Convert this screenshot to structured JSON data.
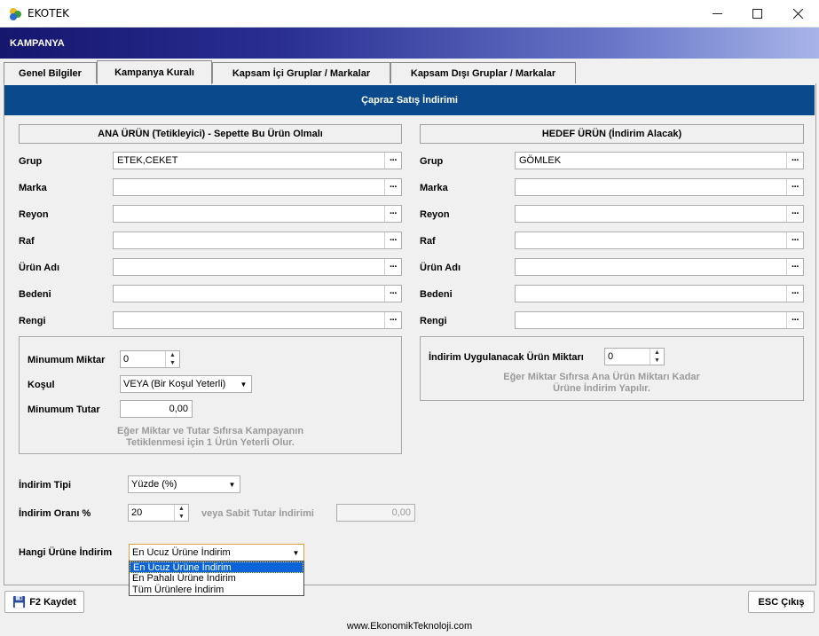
{
  "window": {
    "title": "EKOTEK"
  },
  "banner": {
    "title": "KAMPANYA"
  },
  "tabs": [
    {
      "label": "Genel Bilgiler"
    },
    {
      "label": "Kampanya Kuralı"
    },
    {
      "label": "Kapsam  İçi Gruplar / Markalar"
    },
    {
      "label": "Kapsam Dışı Gruplar / Markalar"
    }
  ],
  "section_title": "Çapraz Satış İndirimi",
  "left": {
    "header": "ANA ÜRÜN (Tetikleyici) - Sepette Bu Ürün Olmalı",
    "fields": [
      {
        "label": "Grup",
        "value": "ETEK,CEKET"
      },
      {
        "label": "Marka",
        "value": ""
      },
      {
        "label": "Reyon",
        "value": ""
      },
      {
        "label": "Raf",
        "value": ""
      },
      {
        "label": "Ürün Adı",
        "value": ""
      },
      {
        "label": "Bedeni",
        "value": ""
      },
      {
        "label": "Rengi",
        "value": ""
      }
    ],
    "min_qty_label": "Minumum Miktar",
    "min_qty_value": "0",
    "condition_label": "Koşul",
    "condition_value": "VEYA (Bir Koşul Yeterli)",
    "min_total_label": "Minumum Tutar",
    "min_total_value": "0,00",
    "hint_line1": "Eğer Miktar ve Tutar Sıfırsa Kampayanın",
    "hint_line2": "Tetiklenmesi için 1 Ürün Yeterli Olur."
  },
  "right": {
    "header": "HEDEF ÜRÜN (İndirim Alacak)",
    "fields": [
      {
        "label": "Grup",
        "value": "GÖMLEK"
      },
      {
        "label": "Marka",
        "value": ""
      },
      {
        "label": "Reyon",
        "value": ""
      },
      {
        "label": "Raf",
        "value": ""
      },
      {
        "label": "Ürün Adı",
        "value": ""
      },
      {
        "label": "Bedeni",
        "value": ""
      },
      {
        "label": "Rengi",
        "value": ""
      }
    ],
    "qty_label": "İndirim Uygulanacak Ürün Miktarı",
    "qty_value": "0",
    "hint_line1": "Eğer Miktar Sıfırsa Ana Ürün Miktarı Kadar",
    "hint_line2": "Ürüne İndirim Yapılır."
  },
  "discount": {
    "type_label": "İndirim Tipi",
    "type_value": "Yüzde (%)",
    "rate_label": "İndirim Oranı %",
    "rate_value": "20",
    "fixed_label": "veya Sabit Tutar İndirimi",
    "fixed_value": "0,00",
    "which_label": "Hangi Ürüne İndirim",
    "which_value": "En Ucuz Ürüne İndirim",
    "which_options": [
      "En Ucuz Ürüne İndirim",
      "En Pahalı Ürüne İndirim",
      "Tüm Ürünlere İndirim"
    ]
  },
  "buttons": {
    "save": "F2 Kaydet",
    "exit": "ESC Çıkış"
  },
  "footer": "www.EkonomikTeknoloji.com"
}
